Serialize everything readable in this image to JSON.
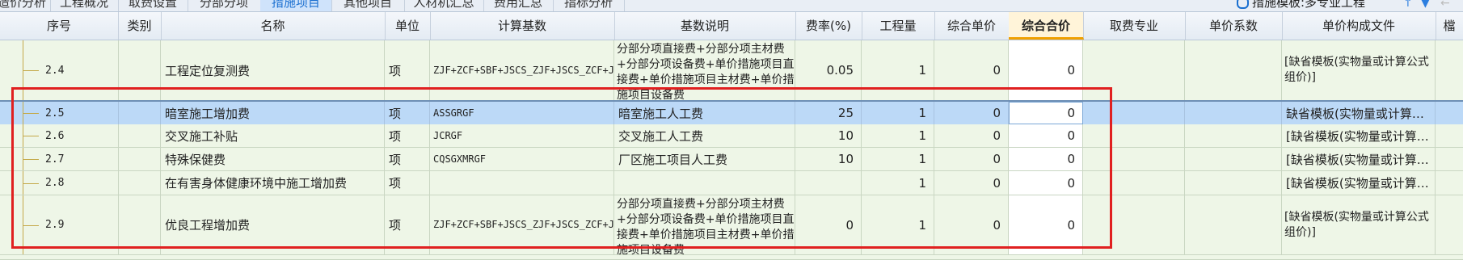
{
  "tabs": [
    {
      "label": "造价分析",
      "active": false
    },
    {
      "label": "工程概况",
      "active": false
    },
    {
      "label": "取费设置",
      "active": false
    },
    {
      "label": "分部分项",
      "active": false
    },
    {
      "label": "措施项目",
      "active": true
    },
    {
      "label": "其他项目",
      "active": false
    },
    {
      "label": "人材机汇总",
      "active": false
    },
    {
      "label": "费用汇总",
      "active": false
    },
    {
      "label": "指标分析",
      "active": false
    }
  ],
  "template_label": "措施模板:多专业工程",
  "columns": {
    "seq": "序号",
    "category": "类别",
    "name": "名称",
    "unit": "单位",
    "base": "计算基数",
    "base_desc": "基数说明",
    "rate": "费率(%)",
    "qty": "工程量",
    "unit_price": "综合单价",
    "total": "综合合价",
    "fee_major": "取费专业",
    "unit_coef": "单价系数",
    "price_file": "单价构成文件",
    "extra": "檔"
  },
  "rows": [
    {
      "seq": "2.4",
      "category": "",
      "name": "工程定位复测费",
      "unit": "项",
      "base": "ZJF+ZCF+SBF+JSCS_ZJF+JSCS_ZCF+JSCS_SBF",
      "base_desc": "分部分项直接费+分部分项主材费+分部分项设备费+单价措施项目直接费+单价措施项目主材费+单价措施项目设备费",
      "rate": "0.05",
      "qty": "1",
      "unit_price": "0",
      "total": "0",
      "fee_major": "",
      "unit_coef": "",
      "price_file": "[缺省模板(实物量或计算公式组价)]"
    },
    {
      "seq": "2.5",
      "category": "",
      "name": "暗室施工增加费",
      "unit": "项",
      "base": "ASSGRGF",
      "base_desc": "暗室施工人工费",
      "rate": "25",
      "qty": "1",
      "unit_price": "0",
      "total": "0",
      "fee_major": "",
      "unit_coef": "",
      "price_file": "缺省模板(实物量或计算…"
    },
    {
      "seq": "2.6",
      "category": "",
      "name": "交叉施工补贴",
      "unit": "项",
      "base": "JCRGF",
      "base_desc": "交叉施工人工费",
      "rate": "10",
      "qty": "1",
      "unit_price": "0",
      "total": "0",
      "fee_major": "",
      "unit_coef": "",
      "price_file": "[缺省模板(实物量或计算…"
    },
    {
      "seq": "2.7",
      "category": "",
      "name": "特殊保健费",
      "unit": "项",
      "base": "CQSGXMRGF",
      "base_desc": "厂区施工项目人工费",
      "rate": "10",
      "qty": "1",
      "unit_price": "0",
      "total": "0",
      "fee_major": "",
      "unit_coef": "",
      "price_file": "[缺省模板(实物量或计算…"
    },
    {
      "seq": "2.8",
      "category": "",
      "name": "在有害身体健康环境中施工增加费",
      "unit": "项",
      "base": "",
      "base_desc": "",
      "rate": "",
      "qty": "1",
      "unit_price": "0",
      "total": "0",
      "fee_major": "",
      "unit_coef": "",
      "price_file": "[缺省模板(实物量或计算…"
    },
    {
      "seq": "2.9",
      "category": "",
      "name": "优良工程增加费",
      "unit": "项",
      "base": "ZJF+ZCF+SBF+JSCS_ZJF+JSCS_ZCF+JSCS_SBF",
      "base_desc": "分部分项直接费+分部分项主材费+分部分项设备费+单价措施项目直接费+单价措施项目主材费+单价措施项目设备费",
      "rate": "0",
      "qty": "1",
      "unit_price": "0",
      "total": "0",
      "fee_major": "",
      "unit_coef": "",
      "price_file": "[缺省模板(实物量或计算公式组价)]"
    }
  ]
}
